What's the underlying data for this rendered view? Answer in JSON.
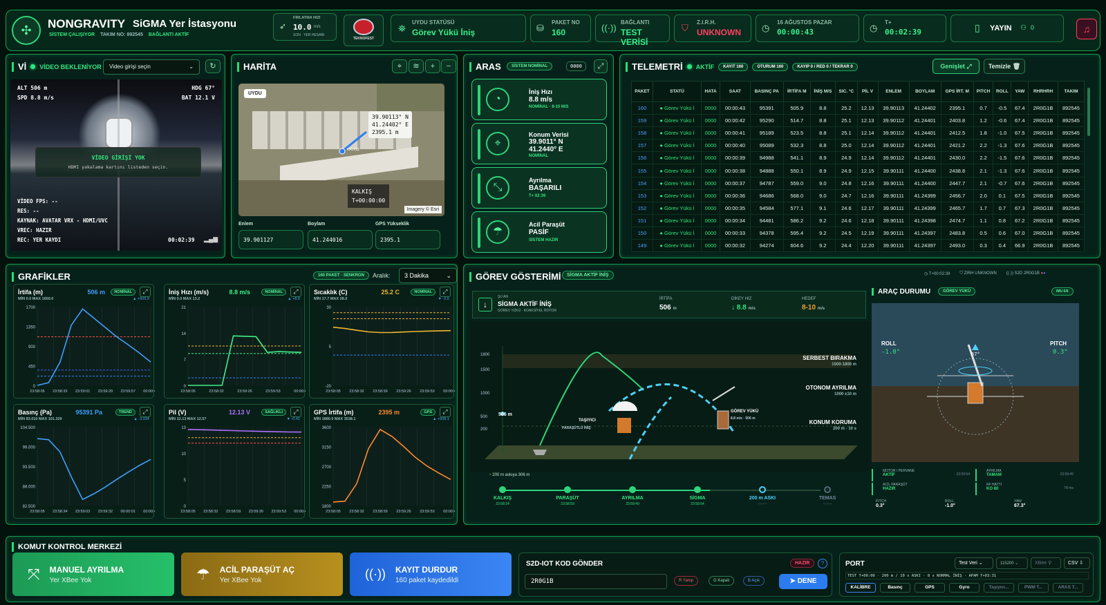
{
  "header": {
    "app": "NONGRAVITY",
    "station": "SiGMA Yer İstasyonu",
    "system": "SİSTEM ÇALIŞIYOR",
    "team": "TAKIM NO: 892545",
    "link": "BAĞLANTI AKTİF",
    "speed_label": "FIRLATMA HIZI",
    "speed_val": "10.0",
    "speed_unit": "m/s",
    "speed_sub": "SON · YER HESABI",
    "logo": "TEKNOFEST",
    "sat_label": "UYDU STATÜSÜ",
    "sat_val": "Görev Yükü İniş",
    "pkt_label": "PAKET NO",
    "pkt_val": "160",
    "conn_label": "BAĞLANTI",
    "conn_val": "TEST VERİSİ",
    "zirh_label": "Z.I.R.H.",
    "zirh_val": "UNKNOWN",
    "date_label": "16 AĞUSTOS PAZAR",
    "date_val": "00:00:43",
    "t_label": "T+",
    "t_val": "00:02:39",
    "yayin": "YAYIN",
    "viewers": "0"
  },
  "video": {
    "title": "Vİ",
    "status": "VİDEO BEKLENİYOR",
    "select": "Video girişi seçin",
    "alt": "ALT  506 m",
    "spd": "SPD  8.8 m/s",
    "hdg": "HDG  67°",
    "bat": "BAT  12.1 V",
    "no_input": "VİDEO GİRİŞİ YOK",
    "hint": "HDMI yakalama kartını listeden seçin.",
    "fps": "VİDEO FPS: --",
    "res": "RES: --",
    "src": "KAYNAK: AVATAR VRX - HDMI/UVC",
    "vrec": "VREC: HAZIR",
    "rec": "REC: YER KAYDI",
    "time": "00:02:39"
  },
  "map": {
    "title": "HARİTA",
    "tag": "UYDU",
    "coord1": "39.90113° N",
    "coord2": "41.24402° E",
    "coord3": "2395.1 m",
    "launch": "KALKIŞ",
    "launch_t": "T+00:00:00",
    "credit": "Imagery © Esri",
    "marker": "KALKIŞ",
    "lat_l": "Enlem",
    "lat": "39.901127",
    "lon_l": "Boylam",
    "lon": "41.244016",
    "gps_l": "GPS Yükseklik",
    "gps": "2395.1"
  },
  "aras": {
    "title": "ARAS",
    "badge": "SİSTEM NOMİNAL",
    "code": "0000",
    "items": [
      {
        "name": "İniş Hızı",
        "val": "8.8 m/s",
        "sub": "NOMİNAL · 8-10 M/S",
        "icon": "◔"
      },
      {
        "name": "Konum Verisi",
        "val": "39.9011° N",
        "val2": "41.2440° E",
        "sub": "NOMİNAL",
        "icon": "⌖"
      },
      {
        "name": "Ayrılma",
        "val": "BAŞARILI",
        "sub": "T+ 02:39",
        "icon": "⤡"
      },
      {
        "name": "Acil Paraşüt",
        "val": "PASİF",
        "sub": "SİSTEM HAZIR",
        "icon": "☂"
      }
    ]
  },
  "telemetry": {
    "title": "TELEMETRİ",
    "active": "AKTİF",
    "b1": "KAYIT 160",
    "b2": "OTURUM 160",
    "b3": "KAYIP 0 / RED 0 / TEKRAR 0",
    "expand": "Genişlet",
    "clear": "Temizle",
    "headers": [
      "PAKET",
      "STATÜ",
      "HATA",
      "SAAT",
      "BASINÇ PA",
      "İRTİFA M",
      "İNİŞ M/S",
      "SIC. °C",
      "PİL V",
      "ENLEM",
      "BOYLAM",
      "GPS İRT. M",
      "PITCH",
      "ROLL",
      "YAW",
      "RHRHRH",
      "TAKIM"
    ],
    "rows": [
      [
        "160",
        "● Görev Yükü İ",
        "0000",
        "00:00:43",
        "95391",
        "505.9",
        "8.8",
        "25.2",
        "12.13",
        "39.90113",
        "41.24402",
        "2395.1",
        "0.7",
        "-0.5",
        "67.4",
        "2R0G1B",
        "892545"
      ],
      [
        "159",
        "● Görev Yükü İ",
        "0000",
        "00:00:42",
        "95290",
        "514.7",
        "8.8",
        "25.1",
        "12.13",
        "39.90112",
        "41.24401",
        "2403.8",
        "1.2",
        "-0.6",
        "67.4",
        "2R0G1B",
        "892545"
      ],
      [
        "158",
        "● Görev Yükü İ",
        "0000",
        "00:00:41",
        "95189",
        "523.5",
        "8.8",
        "25.1",
        "12.14",
        "39.90112",
        "41.24401",
        "2412.5",
        "1.8",
        "-1.0",
        "67.5",
        "2R0G1B",
        "892545"
      ],
      [
        "157",
        "● Görev Yükü İ",
        "0000",
        "00:00:40",
        "95089",
        "532.3",
        "8.8",
        "25.0",
        "12.14",
        "39.90112",
        "41.24401",
        "2421.2",
        "2.2",
        "-1.3",
        "67.6",
        "2R0G1B",
        "892545"
      ],
      [
        "156",
        "● Görev Yükü İ",
        "0000",
        "00:00:39",
        "94988",
        "541.1",
        "8.9",
        "24.9",
        "12.14",
        "39.90112",
        "41.24401",
        "2430.0",
        "2.2",
        "-1.5",
        "67.6",
        "2R0G1B",
        "892545"
      ],
      [
        "155",
        "● Görev Yükü İ",
        "0000",
        "00:00:38",
        "94888",
        "550.1",
        "8.9",
        "24.9",
        "12.15",
        "39.90111",
        "41.24400",
        "2438.8",
        "2.1",
        "-1.3",
        "67.6",
        "2R0G1B",
        "892545"
      ],
      [
        "154",
        "● Görev Yükü İ",
        "0000",
        "00:00:37",
        "94787",
        "559.0",
        "9.0",
        "24.8",
        "12.16",
        "39.90111",
        "41.24400",
        "2447.7",
        "2.1",
        "-0.7",
        "67.6",
        "2R0G1B",
        "892545"
      ],
      [
        "153",
        "● Görev Yükü İ",
        "0000",
        "00:00:36",
        "94686",
        "568.0",
        "9.0",
        "24.7",
        "12.16",
        "39.90111",
        "41.24399",
        "2456.7",
        "2.0",
        "0.1",
        "67.5",
        "2R0G1B",
        "892545"
      ],
      [
        "152",
        "● Görev Yükü İ",
        "0000",
        "00:00:35",
        "94584",
        "577.1",
        "9.1",
        "24.6",
        "12.17",
        "39.90111",
        "41.24399",
        "2465.7",
        "1.7",
        "0.7",
        "67.3",
        "2R0G1B",
        "892545"
      ],
      [
        "151",
        "● Görev Yükü İ",
        "0000",
        "00:00:34",
        "94481",
        "586.2",
        "9.2",
        "24.6",
        "12.18",
        "39.90111",
        "41.24398",
        "2474.7",
        "1.1",
        "0.8",
        "67.2",
        "2R0G1B",
        "892545"
      ],
      [
        "150",
        "● Görev Yükü İ",
        "0000",
        "00:00:33",
        "94378",
        "595.4",
        "9.2",
        "24.5",
        "12.19",
        "39.90111",
        "41.24397",
        "2483.8",
        "0.5",
        "0.6",
        "67.0",
        "2R0G1B",
        "892545"
      ],
      [
        "149",
        "● Görev Yükü İ",
        "0000",
        "00:00:32",
        "94274",
        "604.6",
        "9.2",
        "24.4",
        "12.20",
        "39.90111",
        "41.24397",
        "2493.0",
        "0.3",
        "0.4",
        "66.9",
        "2R0G1B",
        "892545"
      ]
    ]
  },
  "graphs": {
    "title": "GRAFİKLER",
    "badge": "160 PAKET · SENKRON",
    "range_l": "Aralık:",
    "range": "3 Dakika",
    "cards": [
      {
        "name": "İrtifa (m)",
        "val": "506 m",
        "badge": "NOMİNAL",
        "mm": "MİN 0.0  MAX 1650.0",
        "delta": "▲ +505.9",
        "color": "#3ea0ff"
      },
      {
        "name": "İniş Hızı (m/s)",
        "val": "8.8 m/s",
        "badge": "NOMİNAL",
        "mm": "MİN 0.0  MAX 13.2",
        "delta": "▲ +8.8",
        "color": "#3ef08a"
      },
      {
        "name": "Sıcaklık (C)",
        "val": "25.2 C",
        "badge": "NOMİNAL",
        "mm": "MİN 17.7  MAX 28.0",
        "delta": "▼ -2.6",
        "color": "#f0b830"
      },
      {
        "name": "Basınç (Pa)",
        "val": "95391 Pa",
        "badge": "TREND",
        "mm": "MİN 83.010  MAX 101.329",
        "delta": "▲ -3.934",
        "color": "#3ea0ff"
      },
      {
        "name": "Pil (V)",
        "val": "12.13 V",
        "badge": "SAĞLIKLI",
        "mm": "MİN 12.13  MAX 12.57",
        "delta": "▼ -0.41",
        "color": "#b070ff"
      },
      {
        "name": "GPS İrtifa (m)",
        "val": "2395 m",
        "badge": "GPS",
        "mm": "MİN 1880.0  MAX 3538.1",
        "delta": "▲ +506.1",
        "color": "#ff8a30"
      }
    ]
  },
  "chart_data": [
    {
      "type": "line",
      "title": "İrtifa (m)",
      "ylim": [
        0,
        1700
      ],
      "yticks": [
        "1700",
        "1350",
        "900",
        "450",
        "0"
      ],
      "xticks": [
        "23:58:05",
        "23:58:33",
        "23:59:01",
        "23:59:29",
        "23:59:57",
        "00:00:44"
      ],
      "x": [
        0,
        1,
        2,
        3,
        4,
        5,
        6,
        7,
        8,
        9,
        10
      ],
      "series": [
        {
          "values": [
            0,
            60,
            500,
            1300,
            1650,
            1450,
            1250,
            1050,
            880,
            700,
            506
          ]
        }
      ],
      "refs": [
        {
          "y": 1050,
          "c": "#ff5050"
        },
        {
          "y": 330,
          "c": "#4060ff"
        },
        {
          "y": 200,
          "c": "#3080ff"
        }
      ]
    },
    {
      "type": "line",
      "title": "İniş Hızı (m/s)",
      "ylim": [
        0,
        21
      ],
      "yticks": [
        "21",
        "14",
        "7",
        "0"
      ],
      "xticks": [
        "23:58:05",
        "23:58:32",
        "23:59:26",
        "23:59:53",
        "00:00:44"
      ],
      "x": [
        0,
        1,
        2,
        3,
        4,
        5,
        6,
        7,
        8,
        9,
        10
      ],
      "series": [
        {
          "values": [
            0,
            0,
            0,
            0,
            13.2,
            13.1,
            13.0,
            8.8,
            9.0,
            8.9,
            8.8
          ]
        }
      ],
      "refs": [
        {
          "y": 10.5,
          "c": "#f0b830"
        },
        {
          "y": 8.5,
          "c": "#3ef08a"
        },
        {
          "y": 2,
          "c": "#3080ff"
        }
      ]
    },
    {
      "type": "line",
      "title": "Sıcaklık (C)",
      "ylim": [
        -20,
        45
      ],
      "yticks": [
        "30",
        "5",
        "-20"
      ],
      "xticks": [
        "23:58:05",
        "23:58:32",
        "23:58:59",
        "23:59:26",
        "23:59:53",
        "00:00:44"
      ],
      "x": [
        0,
        1,
        2,
        3,
        4,
        5,
        6,
        7,
        8,
        9,
        10
      ],
      "series": [
        {
          "values": [
            28,
            27,
            25.5,
            24.2,
            23.6,
            23.7,
            24.1,
            24.5,
            24.8,
            25.0,
            25.2
          ]
        }
      ],
      "refs": [
        {
          "y": 40,
          "c": "#f0b830"
        },
        {
          "y": 35,
          "c": "#f0b830"
        },
        {
          "y": 5,
          "c": "#3080ff"
        }
      ]
    },
    {
      "type": "line",
      "title": "Basınç (Pa)",
      "ylim": [
        82500,
        104500
      ],
      "yticks": [
        "104.500",
        "99.000",
        "93.500",
        "88.000",
        "82.500"
      ],
      "xticks": [
        "23:58:05",
        "23:58:34",
        "23:59:03",
        "23:59:32",
        "00:00:01",
        "00:00:44"
      ],
      "x": [
        0,
        1,
        2,
        3,
        4,
        5,
        6,
        7,
        8,
        9,
        10
      ],
      "series": [
        {
          "values": [
            101200,
            100900,
            97500,
            90500,
            84200,
            85800,
            87700,
            89800,
            91800,
            93700,
            95391
          ]
        }
      ]
    },
    {
      "type": "line",
      "title": "Pil (V)",
      "ylim": [
        0,
        13
      ],
      "yticks": [
        "13",
        "10",
        "5",
        "0"
      ],
      "xticks": [
        "23:58:05",
        "23:58:32",
        "23:58:59",
        "23:59:26",
        "23:59:53",
        "00:00:44"
      ],
      "x": [
        0,
        1,
        2,
        3,
        4,
        5,
        6,
        7,
        8,
        9,
        10
      ],
      "series": [
        {
          "values": [
            12.57,
            12.52,
            12.47,
            12.42,
            12.37,
            12.32,
            12.27,
            12.22,
            12.18,
            12.15,
            12.13
          ]
        }
      ],
      "refs": [
        {
          "y": 11.2,
          "c": "#f0b830"
        },
        {
          "y": 10.3,
          "c": "#ff5050"
        }
      ]
    },
    {
      "type": "line",
      "title": "GPS İrtifa (m)",
      "ylim": [
        1800,
        3600
      ],
      "yticks": [
        "3600",
        "3150",
        "2700",
        "2250",
        "1800"
      ],
      "xticks": [
        "23:58:05",
        "23:58:32",
        "23:58:59",
        "23:59:26",
        "23:59:53",
        "00:00:44"
      ],
      "x": [
        0,
        1,
        2,
        3,
        4,
        5,
        6,
        7,
        8,
        9,
        10
      ],
      "series": [
        {
          "values": [
            1880,
            1900,
            2300,
            3100,
            3538,
            3380,
            3150,
            2900,
            2700,
            2540,
            2395
          ]
        }
      ]
    }
  ],
  "mission": {
    "title": "GÖREV GÖSTERİMİ",
    "badge": "SİGMA AKTİF İNİŞ",
    "t": "T+00:02:39",
    "zirh": "ZIRH UNKNOWN",
    "s2d": "S2D 2R0G1B",
    "now_l": "ŞU AN",
    "now": "SİGMA AKTİF İNİŞ",
    "now_sub": "GÖREV YÜKÜ · KOAKSİYEL ROTOR",
    "alt_l": "İRTİFA",
    "alt": "506",
    "alt_u": "m",
    "vs_l": "DİKEY HIZ",
    "vs": "↓ 8.8",
    "vs_u": "m/s",
    "tgt_l": "HEDEF",
    "tgt": "8-10",
    "tgt_u": "m/s",
    "z1": "SERBEST BIRAKMA",
    "z1s": "1500-1800 m",
    "z2": "OTONOM AYRILMA",
    "z2s": "1000 ±10 m",
    "z3": "KONUM KORUMA",
    "z3s": "200 m · 10 s",
    "axis": [
      "1800",
      "1500",
      "1000",
      "500",
      "200"
    ],
    "cur": "506 m",
    "carrier": "TAŞIYICI",
    "carrier_s": "PARAŞÜTLÜ İNİŞ",
    "payload": "GÖREV YÜKÜ",
    "payload_s": "8.8 m/s · 506 m",
    "asky": "200 m askıya 306 m",
    "steps": [
      {
        "n": "KALKIŞ",
        "t": "23:58:14"
      },
      {
        "n": "PARAŞÜT",
        "t": "23:58:59"
      },
      {
        "n": "AYRILMA",
        "t": "23:59:49"
      },
      {
        "n": "SİGMA",
        "t": "23:59:54"
      },
      {
        "n": "200 m ASKI",
        "t": "--:--:--"
      },
      {
        "n": "TEMAS",
        "t": "--:--:--"
      }
    ]
  },
  "vehicle": {
    "title": "ARAÇ DURUMU",
    "badge": "GÖREV YÜKÜ",
    "tag": "IMU 6/6",
    "roll_l": "ROLL",
    "roll": "-1.0°",
    "pitch_l": "PITCH",
    "pitch": "0.3°",
    "hdg": "67°",
    "st": [
      {
        "n": "MOTOR / PERVANE",
        "v": "AKTİF",
        "t": "23:59:54"
      },
      {
        "n": "AYRILMA",
        "v": "TAMAM",
        "t": "23:59:49"
      },
      {
        "n": "ACİL PARAŞÜT",
        "v": "HAZIR",
        "t": ""
      },
      {
        "n": "RF HATTI",
        "v": "KO 80",
        "t": "78 ms"
      }
    ],
    "b1l": "PITCH",
    "b1": "0.3°",
    "b2l": "ROLL",
    "b2": "-1.0°",
    "b3l": "YAW",
    "b3": "67.3°"
  },
  "command": {
    "title": "KOMUT KONTROL MERKEZİ",
    "manual": "MANUEL AYRILMA",
    "manual_s": "Yer XBee Yok",
    "para": "ACİL PARAŞÜT AÇ",
    "para_s": "Yer XBee Yok",
    "rec": "KAYIT DURDUR",
    "rec_s": "160 paket kaydedildi",
    "s2d_title": "S2D-IOT KOD GÖNDER",
    "ready": "HAZIR",
    "code": "2R0G1B",
    "r": "R Yanıp",
    "g": "G Kapalı",
    "b": "B Açık",
    "send": "DENE"
  },
  "port": {
    "title": "PORT",
    "mode": "Test Veri",
    "baud": "115200",
    "xbee": "XBee",
    "csv": "CSV",
    "log": "TEST T+00:00 · 200 m / 10 s ASKI · 8 s NORMAL İNİŞ · APAM T+03:31",
    "buttons": [
      "KALİBRE",
      "Basınç",
      "GPS",
      "Gyro",
      "Taşıyıcı...",
      "PWM T...",
      "ARAS T..."
    ]
  },
  "colors": {
    "accent": "#22e07a",
    "blue": "#2c7cf0",
    "orange": "#ff8a30",
    "red": "#ff4060"
  }
}
